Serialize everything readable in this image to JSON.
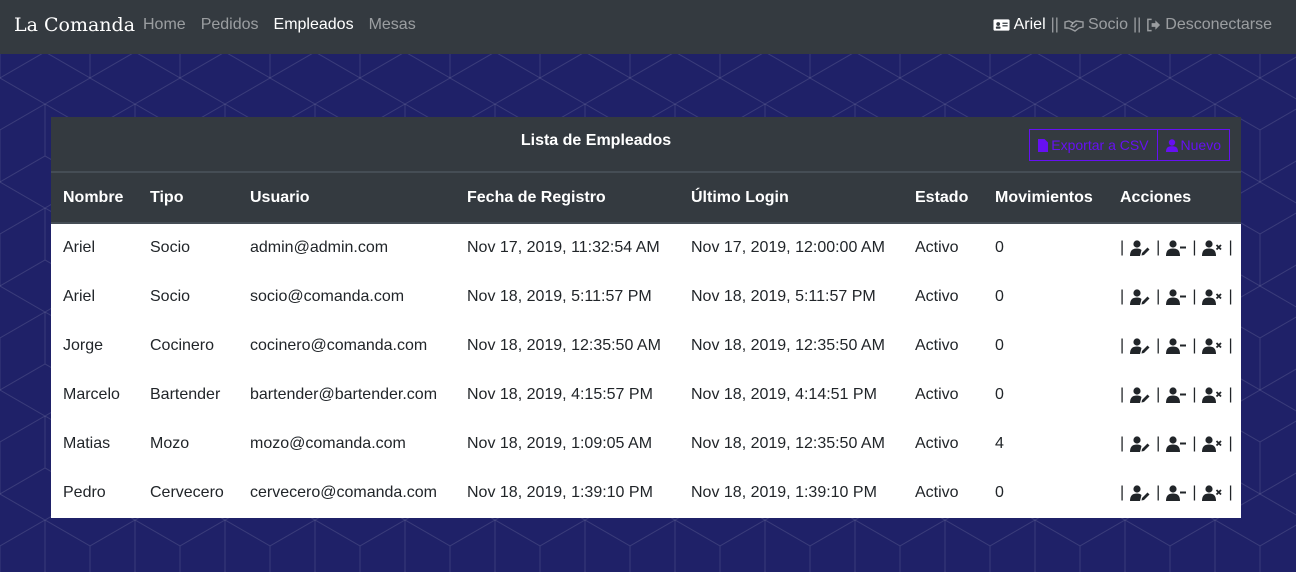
{
  "nav": {
    "brand": "La Comanda",
    "links": [
      "Home",
      "Pedidos",
      "Empleados",
      "Mesas"
    ],
    "active_index": 2,
    "user_label": "Ariel",
    "role_label": "Socio",
    "separator": "||",
    "logout_label": "Desconectarse"
  },
  "card": {
    "title": "Lista de Empleados",
    "export_label": "Exportar a CSV",
    "new_label": "Nuevo",
    "accent_color": "#6610f2"
  },
  "table": {
    "columns": [
      "Nombre",
      "Tipo",
      "Usuario",
      "Fecha de Registro",
      "Último Login",
      "Estado",
      "Movimientos",
      "Acciones"
    ],
    "rows": [
      {
        "nombre": "Ariel",
        "tipo": "Socio",
        "usuario": "admin@admin.com",
        "registro": "Nov 17, 2019, 11:32:54 AM",
        "login": "Nov 17, 2019, 12:00:00 AM",
        "estado": "Activo",
        "movimientos": "0"
      },
      {
        "nombre": "Ariel",
        "tipo": "Socio",
        "usuario": "socio@comanda.com",
        "registro": "Nov 18, 2019, 5:11:57 PM",
        "login": "Nov 18, 2019, 5:11:57 PM",
        "estado": "Activo",
        "movimientos": "0"
      },
      {
        "nombre": "Jorge",
        "tipo": "Cocinero",
        "usuario": "cocinero@comanda.com",
        "registro": "Nov 18, 2019, 12:35:50 AM",
        "login": "Nov 18, 2019, 12:35:50 AM",
        "estado": "Activo",
        "movimientos": "0"
      },
      {
        "nombre": "Marcelo",
        "tipo": "Bartender",
        "usuario": "bartender@bartender.com",
        "registro": "Nov 18, 2019, 4:15:57 PM",
        "login": "Nov 18, 2019, 4:14:51 PM",
        "estado": "Activo",
        "movimientos": "0"
      },
      {
        "nombre": "Matias",
        "tipo": "Mozo",
        "usuario": "mozo@comanda.com",
        "registro": "Nov 18, 2019, 1:09:05 AM",
        "login": "Nov 18, 2019, 12:35:50 AM",
        "estado": "Activo",
        "movimientos": "4"
      },
      {
        "nombre": "Pedro",
        "tipo": "Cervecero",
        "usuario": "cervecero@comanda.com",
        "registro": "Nov 18, 2019, 1:39:10 PM",
        "login": "Nov 18, 2019, 1:39:10 PM",
        "estado": "Activo",
        "movimientos": "0"
      }
    ],
    "action_separator": "|",
    "action_icons": [
      "user-edit-icon",
      "user-minus-icon",
      "user-times-icon"
    ]
  },
  "icons": {
    "user": "id-card-icon",
    "role": "handshake-icon",
    "logout": "sign-out-icon",
    "export": "file-icon",
    "new": "user-icon"
  },
  "colors": {
    "navbar_bg": "#343a40",
    "page_bg": "#1f2168"
  }
}
